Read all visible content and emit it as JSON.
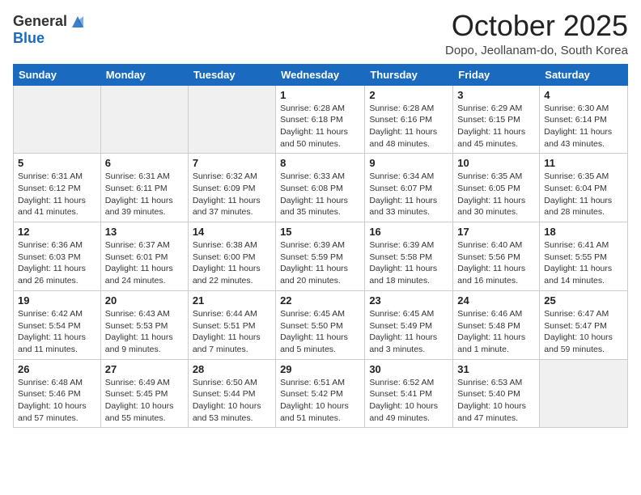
{
  "header": {
    "logo_general": "General",
    "logo_blue": "Blue",
    "month": "October 2025",
    "location": "Dopo, Jeollanam-do, South Korea"
  },
  "days_of_week": [
    "Sunday",
    "Monday",
    "Tuesday",
    "Wednesday",
    "Thursday",
    "Friday",
    "Saturday"
  ],
  "weeks": [
    [
      {
        "num": "",
        "info": ""
      },
      {
        "num": "",
        "info": ""
      },
      {
        "num": "",
        "info": ""
      },
      {
        "num": "1",
        "info": "Sunrise: 6:28 AM\nSunset: 6:18 PM\nDaylight: 11 hours\nand 50 minutes."
      },
      {
        "num": "2",
        "info": "Sunrise: 6:28 AM\nSunset: 6:16 PM\nDaylight: 11 hours\nand 48 minutes."
      },
      {
        "num": "3",
        "info": "Sunrise: 6:29 AM\nSunset: 6:15 PM\nDaylight: 11 hours\nand 45 minutes."
      },
      {
        "num": "4",
        "info": "Sunrise: 6:30 AM\nSunset: 6:14 PM\nDaylight: 11 hours\nand 43 minutes."
      }
    ],
    [
      {
        "num": "5",
        "info": "Sunrise: 6:31 AM\nSunset: 6:12 PM\nDaylight: 11 hours\nand 41 minutes."
      },
      {
        "num": "6",
        "info": "Sunrise: 6:31 AM\nSunset: 6:11 PM\nDaylight: 11 hours\nand 39 minutes."
      },
      {
        "num": "7",
        "info": "Sunrise: 6:32 AM\nSunset: 6:09 PM\nDaylight: 11 hours\nand 37 minutes."
      },
      {
        "num": "8",
        "info": "Sunrise: 6:33 AM\nSunset: 6:08 PM\nDaylight: 11 hours\nand 35 minutes."
      },
      {
        "num": "9",
        "info": "Sunrise: 6:34 AM\nSunset: 6:07 PM\nDaylight: 11 hours\nand 33 minutes."
      },
      {
        "num": "10",
        "info": "Sunrise: 6:35 AM\nSunset: 6:05 PM\nDaylight: 11 hours\nand 30 minutes."
      },
      {
        "num": "11",
        "info": "Sunrise: 6:35 AM\nSunset: 6:04 PM\nDaylight: 11 hours\nand 28 minutes."
      }
    ],
    [
      {
        "num": "12",
        "info": "Sunrise: 6:36 AM\nSunset: 6:03 PM\nDaylight: 11 hours\nand 26 minutes."
      },
      {
        "num": "13",
        "info": "Sunrise: 6:37 AM\nSunset: 6:01 PM\nDaylight: 11 hours\nand 24 minutes."
      },
      {
        "num": "14",
        "info": "Sunrise: 6:38 AM\nSunset: 6:00 PM\nDaylight: 11 hours\nand 22 minutes."
      },
      {
        "num": "15",
        "info": "Sunrise: 6:39 AM\nSunset: 5:59 PM\nDaylight: 11 hours\nand 20 minutes."
      },
      {
        "num": "16",
        "info": "Sunrise: 6:39 AM\nSunset: 5:58 PM\nDaylight: 11 hours\nand 18 minutes."
      },
      {
        "num": "17",
        "info": "Sunrise: 6:40 AM\nSunset: 5:56 PM\nDaylight: 11 hours\nand 16 minutes."
      },
      {
        "num": "18",
        "info": "Sunrise: 6:41 AM\nSunset: 5:55 PM\nDaylight: 11 hours\nand 14 minutes."
      }
    ],
    [
      {
        "num": "19",
        "info": "Sunrise: 6:42 AM\nSunset: 5:54 PM\nDaylight: 11 hours\nand 11 minutes."
      },
      {
        "num": "20",
        "info": "Sunrise: 6:43 AM\nSunset: 5:53 PM\nDaylight: 11 hours\nand 9 minutes."
      },
      {
        "num": "21",
        "info": "Sunrise: 6:44 AM\nSunset: 5:51 PM\nDaylight: 11 hours\nand 7 minutes."
      },
      {
        "num": "22",
        "info": "Sunrise: 6:45 AM\nSunset: 5:50 PM\nDaylight: 11 hours\nand 5 minutes."
      },
      {
        "num": "23",
        "info": "Sunrise: 6:45 AM\nSunset: 5:49 PM\nDaylight: 11 hours\nand 3 minutes."
      },
      {
        "num": "24",
        "info": "Sunrise: 6:46 AM\nSunset: 5:48 PM\nDaylight: 11 hours\nand 1 minute."
      },
      {
        "num": "25",
        "info": "Sunrise: 6:47 AM\nSunset: 5:47 PM\nDaylight: 10 hours\nand 59 minutes."
      }
    ],
    [
      {
        "num": "26",
        "info": "Sunrise: 6:48 AM\nSunset: 5:46 PM\nDaylight: 10 hours\nand 57 minutes."
      },
      {
        "num": "27",
        "info": "Sunrise: 6:49 AM\nSunset: 5:45 PM\nDaylight: 10 hours\nand 55 minutes."
      },
      {
        "num": "28",
        "info": "Sunrise: 6:50 AM\nSunset: 5:44 PM\nDaylight: 10 hours\nand 53 minutes."
      },
      {
        "num": "29",
        "info": "Sunrise: 6:51 AM\nSunset: 5:42 PM\nDaylight: 10 hours\nand 51 minutes."
      },
      {
        "num": "30",
        "info": "Sunrise: 6:52 AM\nSunset: 5:41 PM\nDaylight: 10 hours\nand 49 minutes."
      },
      {
        "num": "31",
        "info": "Sunrise: 6:53 AM\nSunset: 5:40 PM\nDaylight: 10 hours\nand 47 minutes."
      },
      {
        "num": "",
        "info": ""
      }
    ]
  ]
}
